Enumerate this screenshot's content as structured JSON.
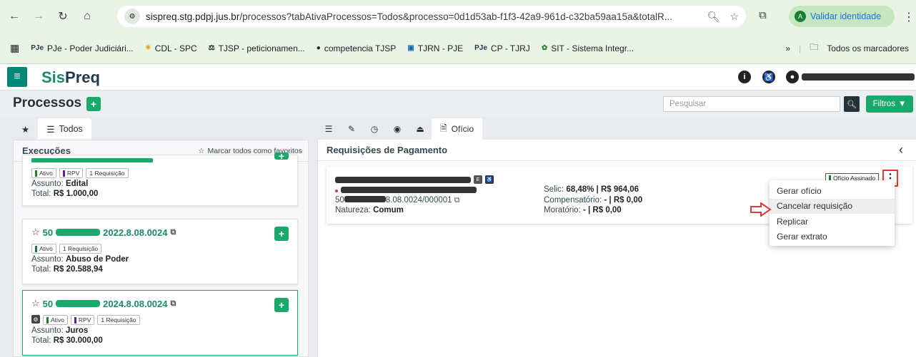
{
  "browser": {
    "url_host": "sispreq.stg.pdpj.jus.br",
    "url_path": "/processos?tabAtivaProcessos=Todos&processo=0d1d53ab-f1f3-42a9-961d-c32ba59aa15a&totalR...",
    "validar_label": "Validar identidade",
    "bookmarks": [
      {
        "icon": "PJe",
        "label": "PJe - Poder Judiciári..."
      },
      {
        "icon": "☀",
        "label": "CDL - SPC"
      },
      {
        "icon": "⚖",
        "label": "TJSP - peticionamen..."
      },
      {
        "icon": "●",
        "label": "competencia TJSP"
      },
      {
        "icon": "▣",
        "label": "TJRN - PJE"
      },
      {
        "icon": "PJe",
        "label": "CP - TJRJ"
      },
      {
        "icon": "✿",
        "label": "SIT - Sistema Integr..."
      }
    ],
    "all_bookmarks_label": "Todos os marcadores"
  },
  "app": {
    "brand_prefix": "Sis",
    "brand_suffix": "Preq",
    "page_title": "Processos",
    "search_placeholder": "Pesquisar",
    "filtros_label": "Filtros"
  },
  "left": {
    "tab_todos": "Todos",
    "panel_title": "Execuções",
    "fav_all_label": "Marcar todos como favoritos",
    "cards": [
      {
        "number_visible": "...",
        "tags": [
          "Ativo",
          "RPV",
          "1 Requisição"
        ],
        "assunto_label": "Assunto:",
        "assunto": "Edital",
        "total_label": "Total:",
        "total": "R$ 1.000,00"
      },
      {
        "number_prefix": "50",
        "number_suffix": "2022.8.08.0024",
        "tags": [
          "Ativo",
          "1 Requisição"
        ],
        "assunto_label": "Assunto:",
        "assunto": "Abuso de Poder",
        "total_label": "Total:",
        "total": "R$ 20.588,94"
      },
      {
        "number_prefix": "50",
        "number_suffix": "2024.8.08.0024",
        "tags": [
          "Ativo",
          "RPV",
          "1 Requisição"
        ],
        "assunto_label": "Assunto:",
        "assunto": "Juros",
        "total_label": "Total:",
        "total": "R$ 30.000,00"
      }
    ]
  },
  "right": {
    "tab_oficio": "Ofício",
    "panel_title": "Requisições de Pagamento",
    "req": {
      "number_prefix": "50",
      "number_suffix": "8.08.0024/000001",
      "natureza_label": "Natureza:",
      "natureza": "Comum",
      "selic_label": "Selic:",
      "selic": "68,48% | R$ 964,06",
      "compensatorio_label": "Compensatório:",
      "compensatorio": "- | R$ 0,00",
      "moratorio_label": "Moratório:",
      "moratorio": "- | R$ 0,00",
      "status_badge": "Ofício Assinado"
    },
    "menu": [
      "Gerar ofício",
      "Cancelar requisição",
      "Replicar",
      "Gerar extrato"
    ]
  },
  "colors": {
    "accent": "#1ba86b",
    "brand_dark": "#1e3a4c",
    "annotation_red": "#e53935"
  }
}
